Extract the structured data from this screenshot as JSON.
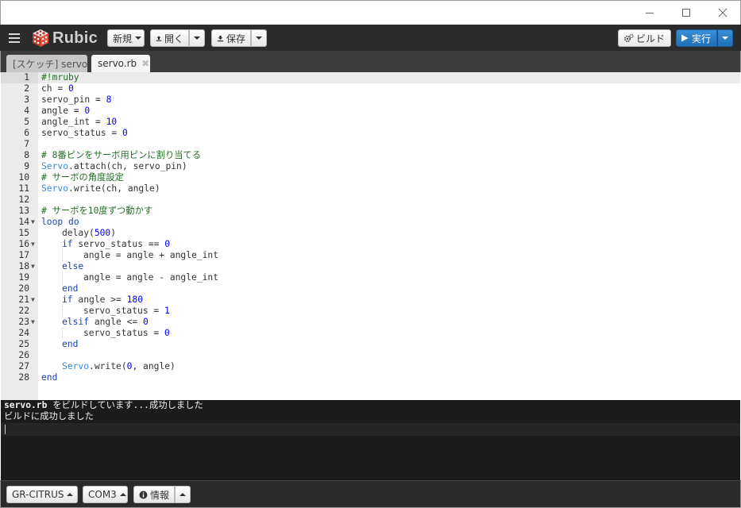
{
  "window": {
    "minimize_icon": "minimize-icon",
    "maximize_icon": "maximize-icon",
    "close_icon": "close-icon"
  },
  "toolbar": {
    "app_name": "Rubic",
    "new_label": "新規",
    "open_label": "開く",
    "save_label": "保存",
    "build_label": "ビルド",
    "run_label": "実行",
    "run_color": "#2a7ec9",
    "toolbar_bg": "#2b2b2b"
  },
  "tabs": [
    {
      "label": "[スケッチ] servo",
      "active": false
    },
    {
      "label": "servo.rb",
      "active": true,
      "close_glyph": "✖"
    }
  ],
  "editor": {
    "lines": [
      {
        "n": "1",
        "fold": false
      },
      {
        "n": "2",
        "fold": false
      },
      {
        "n": "3",
        "fold": false
      },
      {
        "n": "4",
        "fold": false
      },
      {
        "n": "5",
        "fold": false
      },
      {
        "n": "6",
        "fold": false
      },
      {
        "n": "7",
        "fold": false
      },
      {
        "n": "8",
        "fold": false
      },
      {
        "n": "9",
        "fold": false
      },
      {
        "n": "10",
        "fold": false
      },
      {
        "n": "11",
        "fold": false
      },
      {
        "n": "12",
        "fold": false
      },
      {
        "n": "13",
        "fold": false
      },
      {
        "n": "14",
        "fold": true
      },
      {
        "n": "15",
        "fold": false
      },
      {
        "n": "16",
        "fold": true
      },
      {
        "n": "17",
        "fold": false
      },
      {
        "n": "18",
        "fold": true
      },
      {
        "n": "19",
        "fold": false
      },
      {
        "n": "20",
        "fold": false
      },
      {
        "n": "21",
        "fold": true
      },
      {
        "n": "22",
        "fold": false
      },
      {
        "n": "23",
        "fold": true
      },
      {
        "n": "24",
        "fold": false
      },
      {
        "n": "25",
        "fold": false
      },
      {
        "n": "26",
        "fold": false
      },
      {
        "n": "27",
        "fold": false
      },
      {
        "n": "28",
        "fold": false
      }
    ],
    "code": {
      "l1": "#!mruby",
      "l2a": "ch = ",
      "l2b": "0",
      "l3a": "servo_pin = ",
      "l3b": "8",
      "l4a": "angle = ",
      "l4b": "0",
      "l5a": "angle_int = ",
      "l5b": "10",
      "l6a": "servo_status = ",
      "l6b": "0",
      "l8": "# 8番ピンをサーボ用ピンに割り当てる",
      "l9a": "Servo",
      "l9b": ".attach(ch, servo_pin)",
      "l10": "# サーボの角度設定",
      "l11a": "Servo",
      "l11b": ".write(ch, angle)",
      "l13": "# サーボを10度ずつ動かす",
      "l14a": "loop",
      "l14b": " ",
      "l14c": "do",
      "l15a": "delay(",
      "l15b": "500",
      "l15c": ")",
      "l16a": "if",
      "l16b": " servo_status == ",
      "l16c": "0",
      "l17": "angle = angle + angle_int",
      "l18": "else",
      "l19": "angle = angle - angle_int",
      "l20": "end",
      "l21a": "if",
      "l21b": " angle >= ",
      "l21c": "180",
      "l22a": "servo_status = ",
      "l22b": "1",
      "l23a": "elsif",
      "l23b": " angle <= ",
      "l23c": "0",
      "l24a": "servo_status = ",
      "l24b": "0",
      "l25": "end",
      "l27a": "Servo",
      "l27b": ".write(",
      "l27c": "0",
      "l27d": ", angle)",
      "l28": "end"
    }
  },
  "console": {
    "line1_file": "servo.rb",
    "line1_msg": " をビルドしています...成功しました",
    "line2": "ビルドに成功しました"
  },
  "statusbar": {
    "board_label": "GR-CITRUS",
    "port_label": "COM3",
    "info_label": "情報"
  }
}
